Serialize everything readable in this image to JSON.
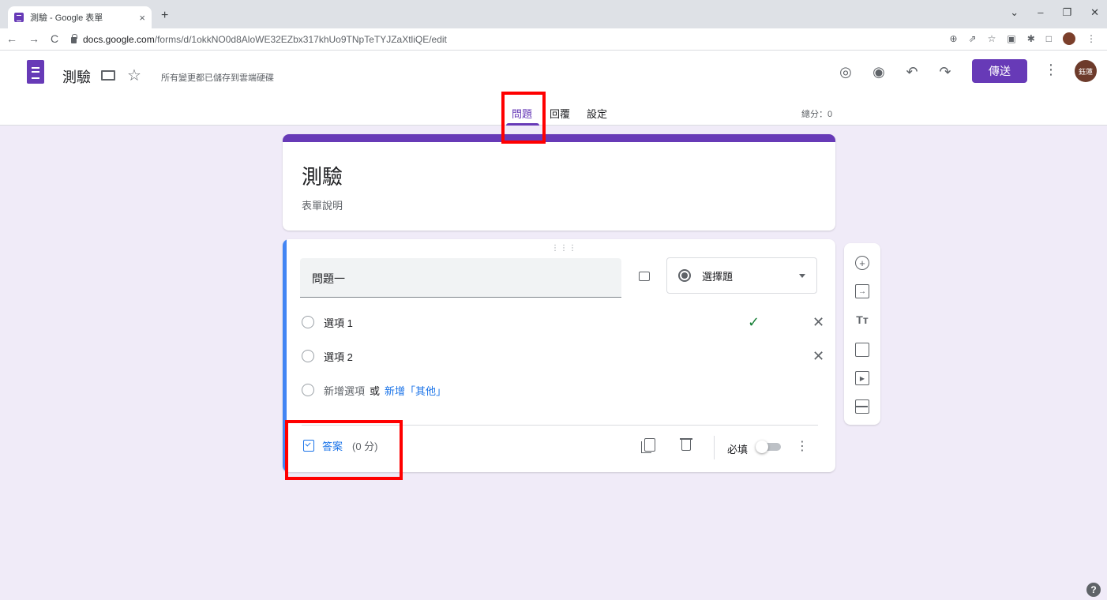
{
  "browser": {
    "tab_title": "測驗 - Google 表單",
    "tab_close": "×",
    "new_tab": "+",
    "window_controls": [
      "⌄",
      "–",
      "❐",
      "✕"
    ],
    "nav": [
      "←",
      "→",
      "C"
    ],
    "url_domain": "docs.google.com",
    "url_path": "/forms/d/1okkNO0d8AloWE32EZbx317khUo9TNpTeTYJZaXtliQE/edit",
    "ext_icons": [
      "⊕",
      "⇗",
      "☆",
      "▣",
      "✱",
      "□"
    ]
  },
  "header": {
    "doc_title": "測驗",
    "save_status": "所有變更都已儲存到雲端硬碟",
    "star": "☆",
    "icons": [
      "◎",
      "◉",
      "↶",
      "↷"
    ],
    "send_label": "傳送",
    "more": "⋮",
    "avatar_text": "鈺蓮"
  },
  "tabs": {
    "questions": "問題",
    "responses": "回覆",
    "settings": "設定",
    "total_score": "總分：0"
  },
  "form": {
    "title": "測驗",
    "description": "表單說明"
  },
  "question": {
    "drag": "⋮⋮⋮",
    "text": "問題一",
    "type": "選擇題",
    "options": [
      "選項 1",
      "選項 2"
    ],
    "check": "✓",
    "remove": "✕",
    "add_option": "新增選項",
    "or": "或",
    "add_other": "新增「其他」",
    "answer_key": "答案",
    "answer_points": "(0 分)",
    "required_label": "必填",
    "more": "⋮"
  },
  "side_toolbar": {
    "add": "+",
    "import": "→",
    "title": "Tт",
    "video": "▶"
  },
  "help": "?",
  "colors": {
    "brand": "#673ab7",
    "background": "#f0ebf8",
    "link": "#1a73e8",
    "highlight": "#ff0000"
  }
}
